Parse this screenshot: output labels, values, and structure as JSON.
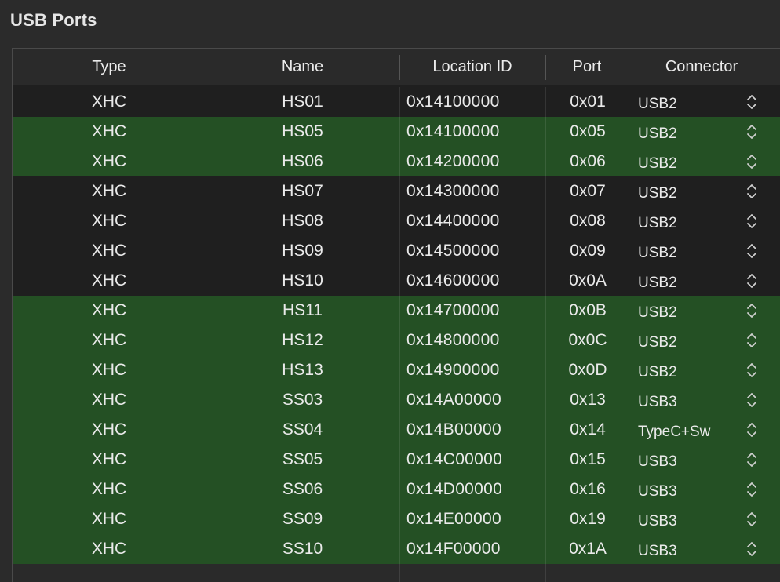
{
  "section": {
    "title": "USB Ports"
  },
  "table": {
    "columns": [
      "Type",
      "Name",
      "Location ID",
      "Port",
      "Connector"
    ],
    "rows": [
      {
        "type": "XHC",
        "name": "HS01",
        "location": "0x14100000",
        "port": "0x01",
        "connector": "USB2",
        "active": false
      },
      {
        "type": "XHC",
        "name": "HS05",
        "location": "0x14100000",
        "port": "0x05",
        "connector": "USB2",
        "active": true
      },
      {
        "type": "XHC",
        "name": "HS06",
        "location": "0x14200000",
        "port": "0x06",
        "connector": "USB2",
        "active": true
      },
      {
        "type": "XHC",
        "name": "HS07",
        "location": "0x14300000",
        "port": "0x07",
        "connector": "USB2",
        "active": false
      },
      {
        "type": "XHC",
        "name": "HS08",
        "location": "0x14400000",
        "port": "0x08",
        "connector": "USB2",
        "active": false
      },
      {
        "type": "XHC",
        "name": "HS09",
        "location": "0x14500000",
        "port": "0x09",
        "connector": "USB2",
        "active": false
      },
      {
        "type": "XHC",
        "name": "HS10",
        "location": "0x14600000",
        "port": "0x0A",
        "connector": "USB2",
        "active": false
      },
      {
        "type": "XHC",
        "name": "HS11",
        "location": "0x14700000",
        "port": "0x0B",
        "connector": "USB2",
        "active": true
      },
      {
        "type": "XHC",
        "name": "HS12",
        "location": "0x14800000",
        "port": "0x0C",
        "connector": "USB2",
        "active": true
      },
      {
        "type": "XHC",
        "name": "HS13",
        "location": "0x14900000",
        "port": "0x0D",
        "connector": "USB2",
        "active": true
      },
      {
        "type": "XHC",
        "name": "SS03",
        "location": "0x14A00000",
        "port": "0x13",
        "connector": "USB3",
        "active": true
      },
      {
        "type": "XHC",
        "name": "SS04",
        "location": "0x14B00000",
        "port": "0x14",
        "connector": "TypeC+Sw",
        "active": true
      },
      {
        "type": "XHC",
        "name": "SS05",
        "location": "0x14C00000",
        "port": "0x15",
        "connector": "USB3",
        "active": true
      },
      {
        "type": "XHC",
        "name": "SS06",
        "location": "0x14D00000",
        "port": "0x16",
        "connector": "USB3",
        "active": true
      },
      {
        "type": "XHC",
        "name": "SS09",
        "location": "0x14E00000",
        "port": "0x19",
        "connector": "USB3",
        "active": true
      },
      {
        "type": "XHC",
        "name": "SS10",
        "location": "0x14F00000",
        "port": "0x1A",
        "connector": "USB3",
        "active": true
      }
    ]
  },
  "colors": {
    "active_row": "#245024",
    "inactive_row": "#1f1f1f",
    "background": "#2b2b2b"
  },
  "icons": {
    "connector_control": "up-down-chevron-icon"
  }
}
